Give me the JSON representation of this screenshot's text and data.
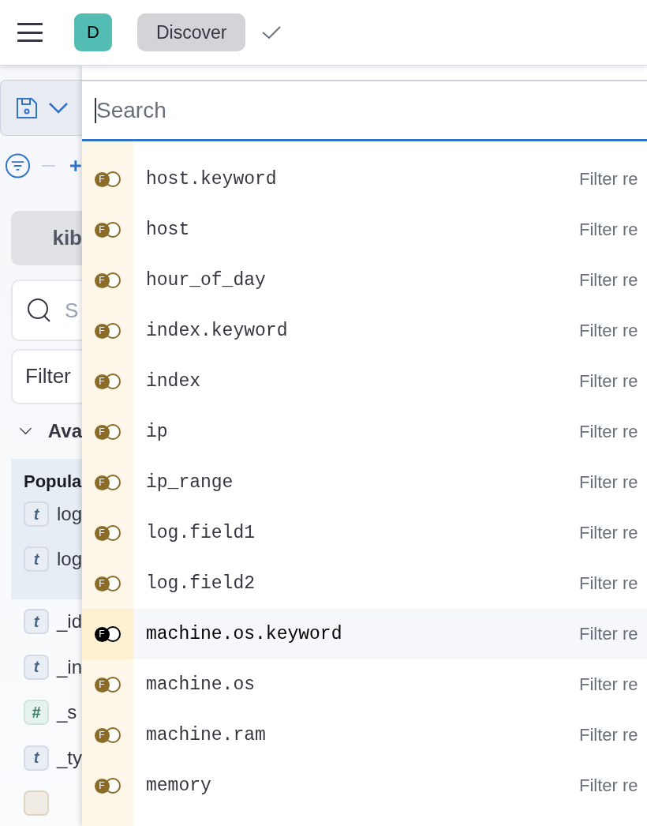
{
  "header": {
    "avatar": "D",
    "breadcrumb": "Discover"
  },
  "query_bar": {
    "search": {
      "placeholder": "Search"
    }
  },
  "sidebar": {
    "index_pattern": "kib",
    "field_search": {
      "placeholder": "S"
    },
    "filter_button": "Filter",
    "available_section": {
      "label": "Ava",
      "expanded": true
    },
    "popular": {
      "title": "Popula",
      "fields": [
        {
          "kind": "string",
          "glyph": "t",
          "name": "log"
        },
        {
          "kind": "string",
          "glyph": "t",
          "name": "log"
        }
      ]
    },
    "fields": [
      {
        "kind": "string",
        "glyph": "t",
        "name": "_id"
      },
      {
        "kind": "string",
        "glyph": "t",
        "name": "_in"
      },
      {
        "kind": "number",
        "glyph": "#",
        "name": "_s"
      },
      {
        "kind": "string",
        "glyph": "t",
        "name": "_ty"
      },
      {
        "kind": "date"
      }
    ]
  },
  "suggestions": [
    {
      "badge": "F",
      "name": "host.keyword",
      "description": "Filter re",
      "selected": false
    },
    {
      "badge": "F",
      "name": "host",
      "description": "Filter re",
      "selected": false
    },
    {
      "badge": "F",
      "name": "hour_of_day",
      "description": "Filter re",
      "selected": false
    },
    {
      "badge": "F",
      "name": "index.keyword",
      "description": "Filter re",
      "selected": false
    },
    {
      "badge": "F",
      "name": "index",
      "description": "Filter re",
      "selected": false
    },
    {
      "badge": "F",
      "name": "ip",
      "description": "Filter re",
      "selected": false
    },
    {
      "badge": "F",
      "name": "ip_range",
      "description": "Filter re",
      "selected": false
    },
    {
      "badge": "F",
      "name": "log.field1",
      "description": "Filter re",
      "selected": false
    },
    {
      "badge": "F",
      "name": "log.field2",
      "description": "Filter re",
      "selected": false
    },
    {
      "badge": "F",
      "name": "machine.os.keyword",
      "description": "Filter re",
      "selected": true
    },
    {
      "badge": "F",
      "name": "machine.os",
      "description": "Filter re",
      "selected": false
    },
    {
      "badge": "F",
      "name": "machine.ram",
      "description": "Filter re",
      "selected": false
    },
    {
      "badge": "F",
      "name": "memory",
      "description": "Filter re",
      "selected": false
    }
  ]
}
